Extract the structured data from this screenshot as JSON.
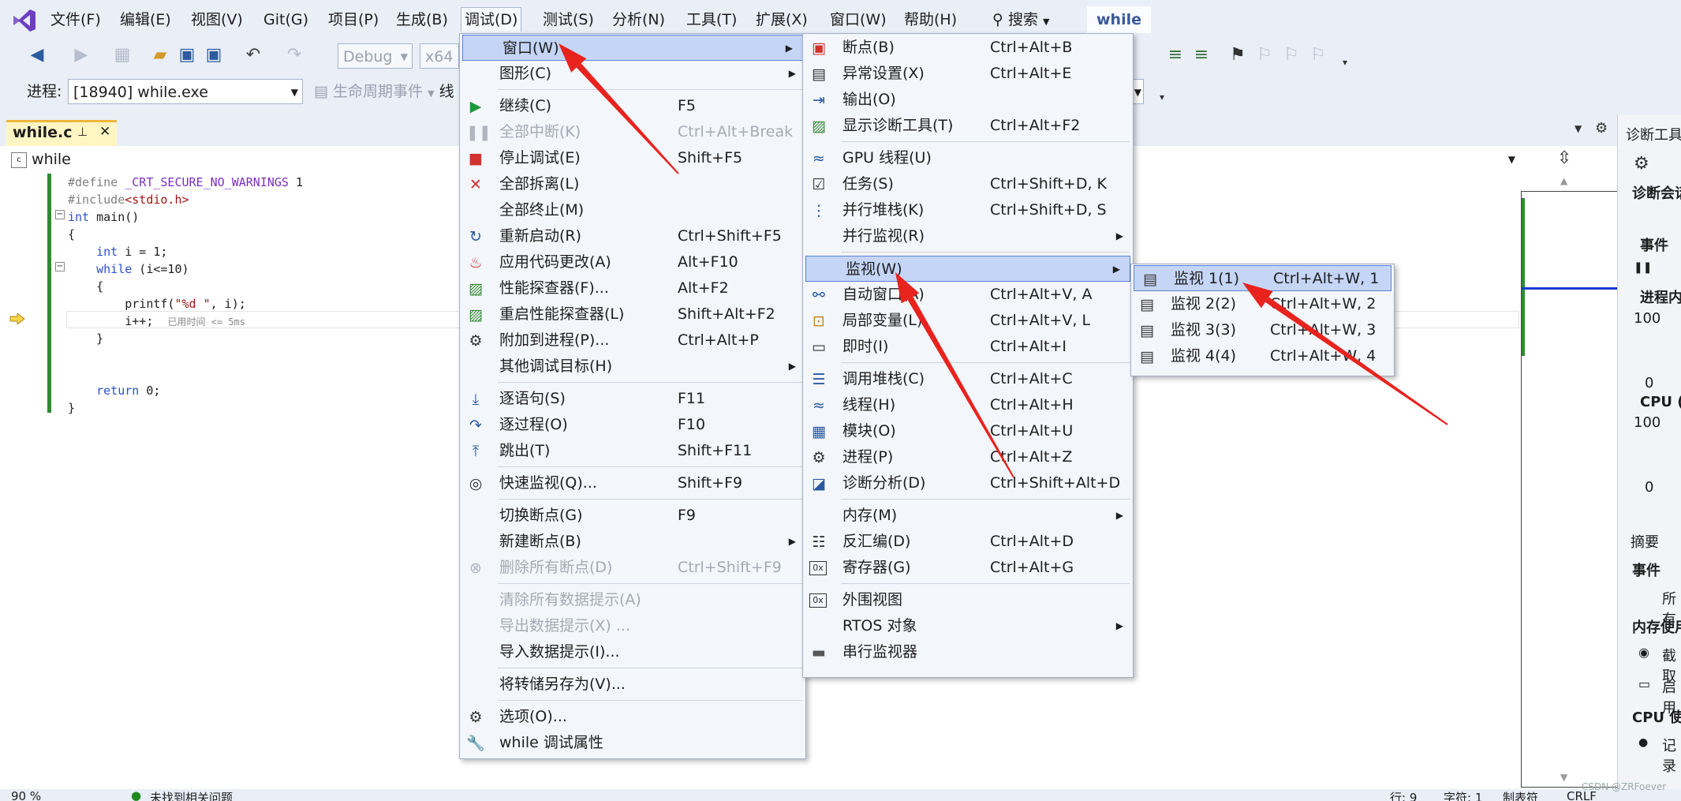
{
  "menubar": {
    "items": [
      "文件(F)",
      "编辑(E)",
      "视图(V)",
      "Git(G)",
      "项目(P)",
      "生成(B)",
      "调试(D)",
      "测试(S)",
      "分析(N)",
      "工具(T)",
      "扩展(X)",
      "窗口(W)",
      "帮助(H)"
    ],
    "search": "搜索",
    "solution": "while"
  },
  "toolbar": {
    "config": "Debug",
    "platform": "x64",
    "process_label": "进程:",
    "process_value": "[18940] while.exe",
    "lifecycle": "生命周期事件",
    "thread_label": "线"
  },
  "tab": {
    "title": "while.c",
    "pin": "⊥",
    "close": "✕"
  },
  "navbar": {
    "scope": "while"
  },
  "code": [
    "#define _CRT_SECURE_NO_WARNINGS 1",
    "#include<stdio.h>",
    "int main()",
    "{",
    "    int i = 1;",
    "    while (i<=10)",
    "    {",
    "        printf(\"%d \", i);",
    "        i++;",
    "    }",
    "",
    "",
    "    return 0;",
    "}"
  ],
  "elapsed": "已用时间 <= 5ms",
  "statusbar": {
    "zoom": "90 %",
    "issues": "未找到相关问题",
    "line": "行: 9",
    "char": "字符: 1",
    "tab": "制表符",
    "eol": "CRLF"
  },
  "rpanel": {
    "title": "诊断工具",
    "session": "诊断会话",
    "events": "事件",
    "process_mem": "进程内",
    "cpu": "CPU (",
    "v100a": "100",
    "v0a": "0",
    "v100b": "100",
    "v0b": "0",
    "tab_summary": "摘要",
    "events2": "事件",
    "all": "所有",
    "mem_usage": "内存使用",
    "snapshot": "截取",
    "enable": "启用",
    "cpu_usage": "CPU 使",
    "record": "记录"
  },
  "debug_menu": [
    {
      "label": "窗口(W)",
      "shortcut": "",
      "sub": true,
      "icon": "",
      "state": "highlight"
    },
    {
      "label": "图形(C)",
      "shortcut": "",
      "sub": true,
      "icon": ""
    },
    {
      "label": "继续(C)",
      "shortcut": "F5",
      "icon": "play-icon"
    },
    {
      "label": "全部中断(K)",
      "shortcut": "Ctrl+Alt+Break",
      "icon": "pause-icon",
      "state": "disabled"
    },
    {
      "label": "停止调试(E)",
      "shortcut": "Shift+F5",
      "icon": "stop-icon"
    },
    {
      "label": "全部拆离(L)",
      "shortcut": "",
      "icon": "detach-icon"
    },
    {
      "label": "全部终止(M)",
      "shortcut": "",
      "icon": ""
    },
    {
      "label": "重新启动(R)",
      "shortcut": "Ctrl+Shift+F5",
      "icon": "restart-icon"
    },
    {
      "label": "应用代码更改(A)",
      "shortcut": "Alt+F10",
      "icon": "hot-reload-icon"
    },
    {
      "label": "性能探查器(F)...",
      "shortcut": "Alt+F2",
      "icon": "profiler-icon"
    },
    {
      "label": "重启性能探查器(L)",
      "shortcut": "Shift+Alt+F2",
      "icon": "profiler-restart-icon"
    },
    {
      "label": "附加到进程(P)...",
      "shortcut": "Ctrl+Alt+P",
      "icon": "attach-icon"
    },
    {
      "label": "其他调试目标(H)",
      "shortcut": "",
      "sub": true,
      "icon": ""
    },
    {
      "label": "逐语句(S)",
      "shortcut": "F11",
      "icon": "step-into-icon"
    },
    {
      "label": "逐过程(O)",
      "shortcut": "F10",
      "icon": "step-over-icon"
    },
    {
      "label": "跳出(T)",
      "shortcut": "Shift+F11",
      "icon": "step-out-icon"
    },
    {
      "label": "快速监视(Q)...",
      "shortcut": "Shift+F9",
      "icon": "glasses-icon"
    },
    {
      "label": "切换断点(G)",
      "shortcut": "F9",
      "icon": ""
    },
    {
      "label": "新建断点(B)",
      "shortcut": "",
      "sub": true,
      "icon": ""
    },
    {
      "label": "删除所有断点(D)",
      "shortcut": "Ctrl+Shift+F9",
      "icon": "delete-breakpoints-icon",
      "state": "disabled"
    },
    {
      "label": "清除所有数据提示(A)",
      "shortcut": "",
      "icon": "",
      "state": "disabled"
    },
    {
      "label": "导出数据提示(X) ...",
      "shortcut": "",
      "icon": "",
      "state": "disabled"
    },
    {
      "label": "导入数据提示(I)...",
      "shortcut": "",
      "icon": ""
    },
    {
      "label": "将转储另存为(V)...",
      "shortcut": "",
      "icon": ""
    },
    {
      "label": "选项(O)...",
      "shortcut": "",
      "icon": "gear-icon"
    },
    {
      "label": "while 调试属性",
      "shortcut": "",
      "icon": "wrench-icon"
    }
  ],
  "window_menu": [
    {
      "label": "断点(B)",
      "shortcut": "Ctrl+Alt+B",
      "icon": "breakpoints-icon"
    },
    {
      "label": "异常设置(X)",
      "shortcut": "Ctrl+Alt+E",
      "icon": "exception-icon"
    },
    {
      "label": "输出(O)",
      "shortcut": "",
      "icon": "output-icon"
    },
    {
      "label": "显示诊断工具(T)",
      "shortcut": "Ctrl+Alt+F2",
      "icon": "diagnostics-icon"
    },
    {
      "label": "GPU 线程(U)",
      "shortcut": "",
      "icon": "gpu-threads-icon"
    },
    {
      "label": "任务(S)",
      "shortcut": "Ctrl+Shift+D, K",
      "icon": "tasks-icon"
    },
    {
      "label": "并行堆栈(K)",
      "shortcut": "Ctrl+Shift+D, S",
      "icon": "parallel-stacks-icon"
    },
    {
      "label": "并行监视(R)",
      "shortcut": "",
      "sub": true,
      "icon": ""
    },
    {
      "label": "监视(W)",
      "shortcut": "",
      "sub": true,
      "icon": "",
      "state": "highlight"
    },
    {
      "label": "自动窗口(A)",
      "shortcut": "Ctrl+Alt+V, A",
      "icon": "autos-icon"
    },
    {
      "label": "局部变量(L)",
      "shortcut": "Ctrl+Alt+V, L",
      "icon": "locals-icon"
    },
    {
      "label": "即时(I)",
      "shortcut": "Ctrl+Alt+I",
      "icon": "immediate-icon"
    },
    {
      "label": "调用堆栈(C)",
      "shortcut": "Ctrl+Alt+C",
      "icon": "call-stack-icon"
    },
    {
      "label": "线程(H)",
      "shortcut": "Ctrl+Alt+H",
      "icon": "threads-icon"
    },
    {
      "label": "模块(O)",
      "shortcut": "Ctrl+Alt+U",
      "icon": "modules-icon"
    },
    {
      "label": "进程(P)",
      "shortcut": "Ctrl+Alt+Z",
      "icon": "processes-icon"
    },
    {
      "label": "诊断分析(D)",
      "shortcut": "Ctrl+Shift+Alt+D",
      "icon": "diag-analysis-icon"
    },
    {
      "label": "内存(M)",
      "shortcut": "",
      "sub": true,
      "icon": ""
    },
    {
      "label": "反汇编(D)",
      "shortcut": "Ctrl+Alt+D",
      "icon": "disassembly-icon"
    },
    {
      "label": "寄存器(G)",
      "shortcut": "Ctrl+Alt+G",
      "icon": "registers-icon"
    },
    {
      "label": "外围视图",
      "shortcut": "",
      "icon": "peripheral-icon"
    },
    {
      "label": "RTOS 对象",
      "shortcut": "",
      "sub": true,
      "icon": ""
    },
    {
      "label": "串行监视器",
      "shortcut": "",
      "icon": "serial-monitor-icon"
    }
  ],
  "watch_menu": [
    {
      "label": "监视 1(1)",
      "shortcut": "Ctrl+Alt+W, 1",
      "icon": "watch-icon",
      "state": "highlight"
    },
    {
      "label": "监视 2(2)",
      "shortcut": "Ctrl+Alt+W, 2",
      "icon": "watch-icon"
    },
    {
      "label": "监视 3(3)",
      "shortcut": "Ctrl+Alt+W, 3",
      "icon": "watch-icon"
    },
    {
      "label": "监视 4(4)",
      "shortcut": "Ctrl+Alt+W, 4",
      "icon": "watch-icon"
    }
  ],
  "watermark": "CSDN @ZRFoever",
  "colors": {
    "accent": "#5a82d6",
    "highlight": "#c4d5f6",
    "arrow": "#e8231e",
    "tab": "#fff6c4"
  }
}
